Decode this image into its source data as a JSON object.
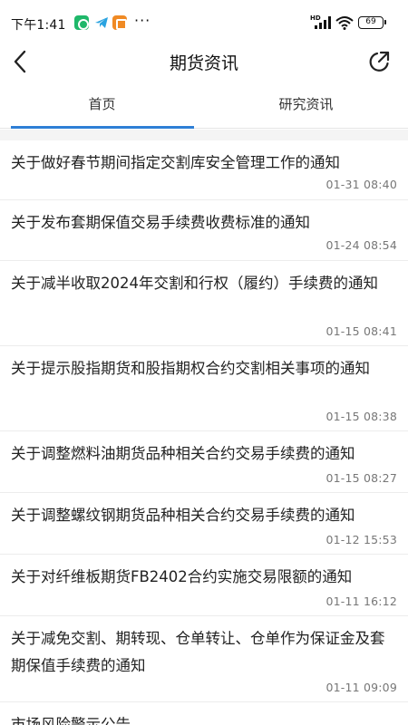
{
  "status_bar": {
    "time": "下午1:41",
    "more": "···",
    "network": "HD",
    "battery": "69"
  },
  "header": {
    "title": "期货资讯",
    "back_icon": "chevron-left-icon",
    "share_icon": "share-external-icon"
  },
  "tabs": [
    {
      "label": "首页",
      "active": true
    },
    {
      "label": "研究资讯",
      "active": false
    }
  ],
  "colors": {
    "accent": "#2e7fd6",
    "divider": "#ececec",
    "time_text": "#777777"
  },
  "news": [
    {
      "title": "关于做好春节期间指定交割库安全管理工作的通知",
      "time": "01-31 08:40"
    },
    {
      "title": "关于发布套期保值交易手续费收费标准的通知",
      "time": "01-24 08:54"
    },
    {
      "title": "关于减半收取2024年交割和行权（履约）手续费的通知",
      "time": "01-15 08:41"
    },
    {
      "title": "关于提示股指期货和股指期权合约交割相关事项的通知",
      "time": "01-15 08:38"
    },
    {
      "title": "关于调整燃料油期货品种相关合约交易手续费的通知",
      "time": "01-15 08:27"
    },
    {
      "title": "关于调整螺纹钢期货品种相关合约交易手续费的通知",
      "time": "01-12 15:53"
    },
    {
      "title": "关于对纤维板期货FB2402合约实施交易限额的通知",
      "time": "01-11 16:12"
    },
    {
      "title": "关于减免交割、期转现、仓单转让、仓单作为保证金及套期保值手续费的通知",
      "time": "01-11 09:09"
    },
    {
      "title": "市场风险警示公告",
      "time": ""
    }
  ]
}
